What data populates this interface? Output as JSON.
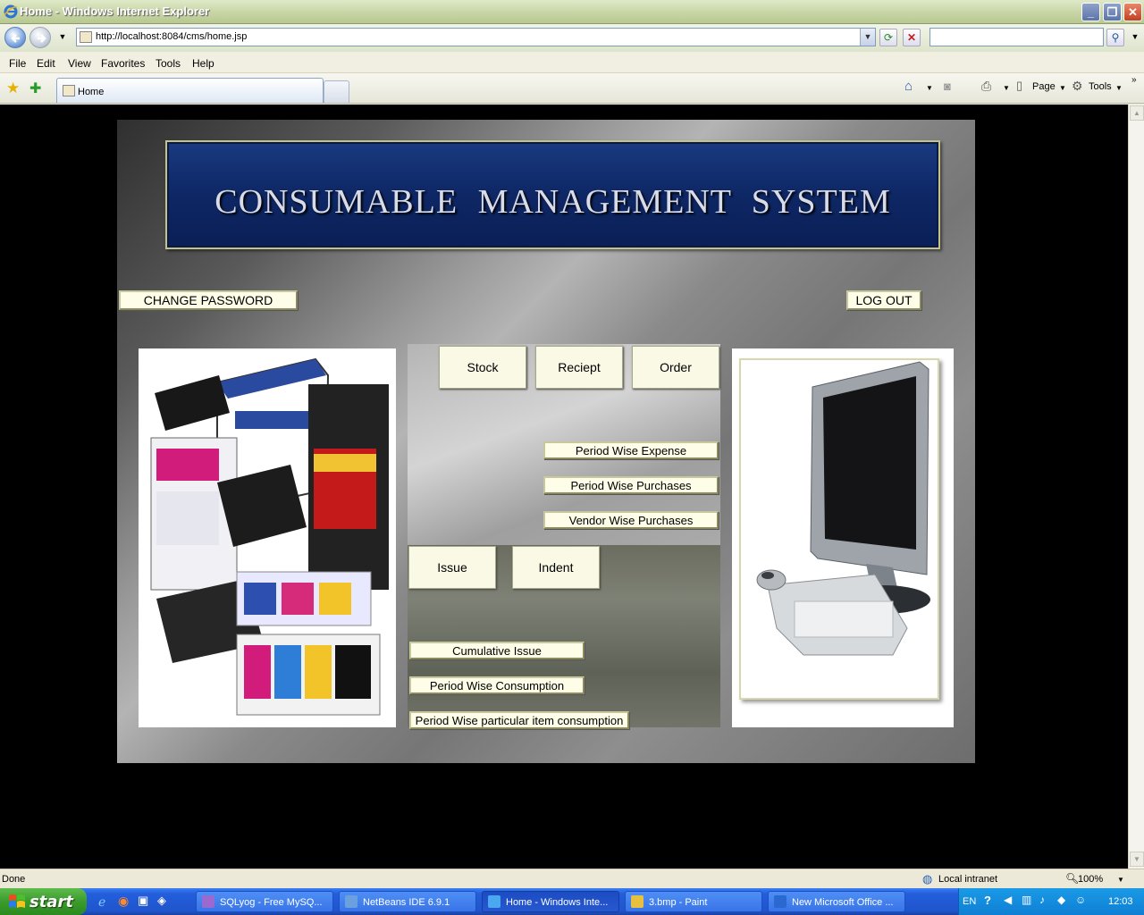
{
  "window": {
    "title": "Home - Windows Internet Explorer"
  },
  "address": {
    "url": "http://localhost:8084/cms/home.jsp"
  },
  "menu": {
    "items": [
      "File",
      "Edit",
      "View",
      "Favorites",
      "Tools",
      "Help"
    ]
  },
  "tabs": {
    "active_label": "Home"
  },
  "commandbar": {
    "page_label": "Page",
    "tools_label": "Tools"
  },
  "page": {
    "banner_title": "CONSUMABLE  MANAGEMENT  SYSTEM",
    "change_password": "CHANGE PASSWORD",
    "logout": "LOG OUT",
    "buttons": {
      "stock": "Stock",
      "reciept": "Reciept",
      "order": "Order",
      "period_wise_expense": "Period Wise Expense",
      "period_wise_purchases": "Period Wise Purchases",
      "vendor_wise_purchases": "Vendor Wise Purchases",
      "issue": "Issue",
      "indent": "Indent",
      "cumulative_issue": "Cumulative Issue",
      "period_wise_consumption": "Period Wise Consumption",
      "period_wise_particular": "Period Wise particular item consumption"
    }
  },
  "status": {
    "left": "Done",
    "zone": "Local intranet",
    "zoom": "100%"
  },
  "taskbar": {
    "start": "start",
    "tasks": [
      "SQLyog - Free MySQ...",
      "NetBeans IDE 6.9.1",
      "Home - Windows Inte...",
      "3.bmp - Paint",
      "New Microsoft Office ..."
    ],
    "lang": "EN",
    "clock": "12:03"
  },
  "colors": {
    "banner_navy": "#0e2765",
    "button_cream": "#fdfde8",
    "xp_blue": "#245edc"
  }
}
